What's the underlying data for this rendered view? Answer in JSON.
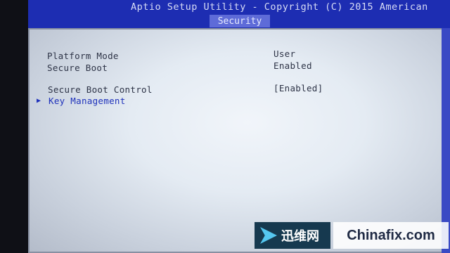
{
  "header": {
    "title": "Aptio Setup Utility - Copyright (C) 2015 American",
    "active_tab": "Security"
  },
  "settings": [
    {
      "label": "Platform Mode",
      "value": "User"
    },
    {
      "label": "Secure Boot",
      "value": "Enabled"
    },
    {
      "label": "Secure Boot Control",
      "value": "[Enabled]"
    },
    {
      "label": "Key Management",
      "value": ""
    }
  ],
  "watermark": {
    "cn_brand": "迅维网",
    "site": "Chinafix.com"
  }
}
